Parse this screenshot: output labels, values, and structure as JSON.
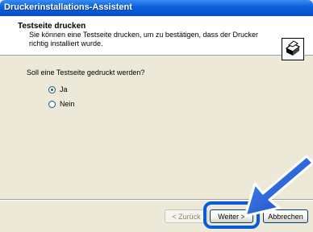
{
  "window": {
    "title": "Druckerinstallations-Assistent"
  },
  "header": {
    "title": "Testseite drucken",
    "subtitle": "Sie können eine Testseite drucken, um zu bestätigen, dass der Drucker richtig installiert wurde.",
    "icon": "printer-icon"
  },
  "body": {
    "question": "Soll eine Testseite gedruckt werden?",
    "options": [
      {
        "label": "Ja",
        "selected": true
      },
      {
        "label": "Nein",
        "selected": false
      }
    ]
  },
  "buttons": {
    "back": "< Zurück",
    "next": "Weiter >",
    "cancel": "Abbrechen"
  },
  "colors": {
    "titlebar": "#0a5fd8",
    "highlight": "#0a5bd6",
    "arrow": "#1f63e0"
  }
}
